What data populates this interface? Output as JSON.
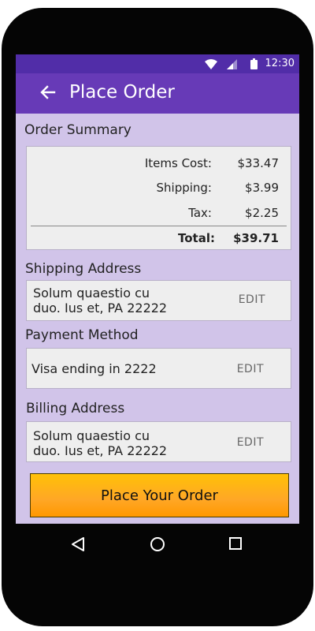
{
  "status_bar": {
    "time": "12:30",
    "icons": [
      "wifi-icon",
      "signal-icon",
      "battery-icon"
    ]
  },
  "app_bar": {
    "back_icon": "arrow-left-icon",
    "title": "Place Order"
  },
  "order_summary": {
    "heading": "Order Summary",
    "rows": [
      {
        "label": "Items Cost:",
        "value": "$33.47"
      },
      {
        "label": "Shipping:",
        "value": "$3.99"
      },
      {
        "label": "Tax:",
        "value": "$2.25"
      }
    ],
    "total": {
      "label": "Total:",
      "value": "$39.71"
    }
  },
  "shipping_address": {
    "heading": "Shipping Address",
    "line1": "Solum quaestio cu",
    "line2": "duo. Ius et, PA 22222",
    "edit_label": "EDIT"
  },
  "payment_method": {
    "heading": "Payment Method",
    "text": "Visa ending in 2222",
    "edit_label": "EDIT"
  },
  "billing_address": {
    "heading": "Billing Address",
    "line1": "Solum quaestio cu",
    "line2": "duo. Ius et, PA 22222",
    "edit_label": "EDIT"
  },
  "place_order_button": {
    "label": "Place Your Order"
  },
  "nav_bar": {
    "icons": [
      "back-triangle-icon",
      "home-circle-icon",
      "recents-square-icon"
    ]
  },
  "colors": {
    "status_bar": "#512da8",
    "app_bar": "#673ab7",
    "screen_background": "#d1c4e9",
    "card_background": "#eeeeee",
    "button_top": "#ffc107",
    "button_bottom": "#ff9800"
  }
}
